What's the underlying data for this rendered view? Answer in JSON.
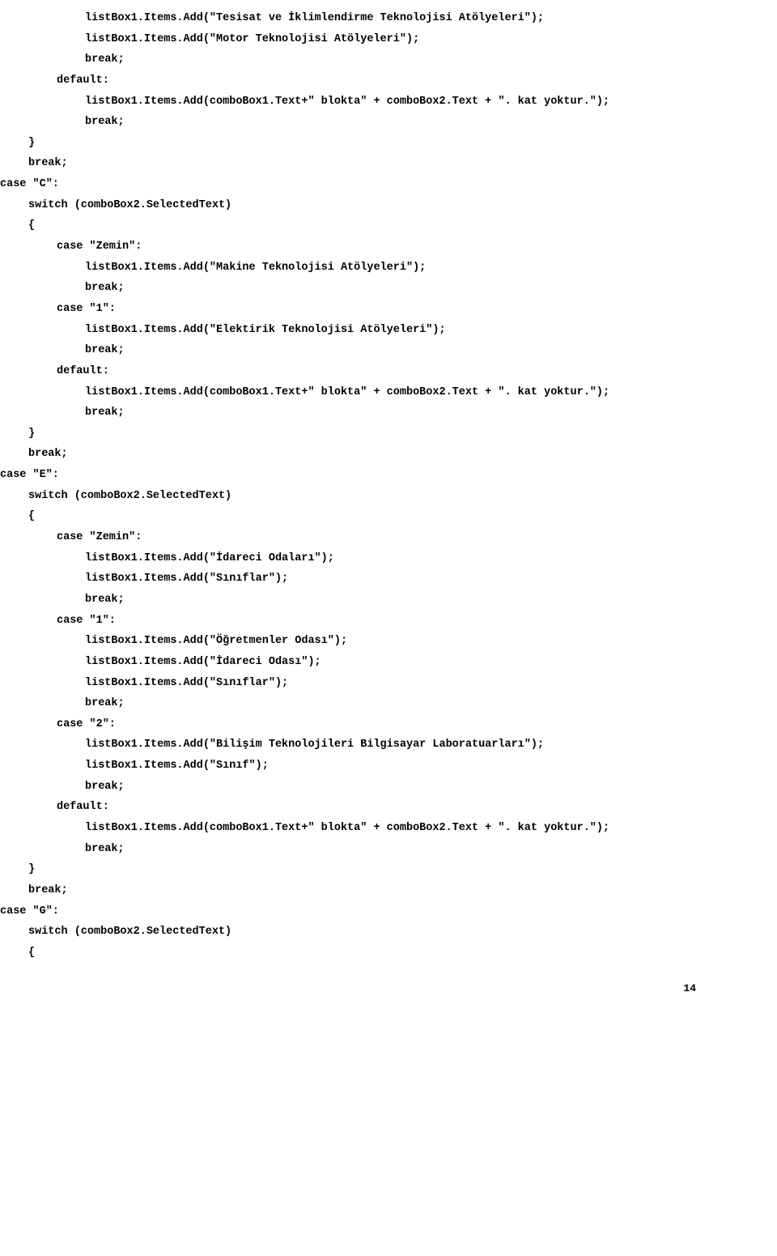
{
  "lines": [
    {
      "cls": "i3",
      "t": "listBox1.Items.Add(\"Tesisat ve İklimlendirme Teknolojisi Atölyeleri\");"
    },
    {
      "cls": "i3",
      "t": "listBox1.Items.Add(\"Motor Teknolojisi Atölyeleri\");"
    },
    {
      "cls": "i3",
      "t": "break;"
    },
    {
      "cls": "i2",
      "t": "default:"
    },
    {
      "cls": "i3",
      "t": "listBox1.Items.Add(comboBox1.Text+\" blokta\" + comboBox2.Text + \". kat yoktur.\");"
    },
    {
      "cls": "i3",
      "t": "break;"
    },
    {
      "cls": "i1",
      "t": "}"
    },
    {
      "cls": "i1",
      "t": "break;"
    },
    {
      "cls": "i0",
      "t": "case \"C\":"
    },
    {
      "cls": "i1",
      "t": "switch (comboBox2.SelectedText)"
    },
    {
      "cls": "i1",
      "t": "{"
    },
    {
      "cls": "i2",
      "t": "case \"Zemin\":"
    },
    {
      "cls": "i3",
      "t": "listBox1.Items.Add(\"Makine Teknolojisi Atölyeleri\");"
    },
    {
      "cls": "i3",
      "t": "break;"
    },
    {
      "cls": "i2",
      "t": "case \"1\":"
    },
    {
      "cls": "i3",
      "t": "listBox1.Items.Add(\"Elektirik Teknolojisi Atölyeleri\");"
    },
    {
      "cls": "i3",
      "t": "break;"
    },
    {
      "cls": "i2",
      "t": "default:"
    },
    {
      "cls": "i3",
      "t": "listBox1.Items.Add(comboBox1.Text+\" blokta\" + comboBox2.Text + \". kat yoktur.\");"
    },
    {
      "cls": "i3",
      "t": "break;"
    },
    {
      "cls": "i1",
      "t": "}"
    },
    {
      "cls": "i1",
      "t": "break;"
    },
    {
      "cls": "i0",
      "t": "case \"E\":"
    },
    {
      "cls": "i1",
      "t": "switch (comboBox2.SelectedText)"
    },
    {
      "cls": "i1",
      "t": "{"
    },
    {
      "cls": "i2",
      "t": "case \"Zemin\":"
    },
    {
      "cls": "i3",
      "t": "listBox1.Items.Add(\"İdareci Odaları\");"
    },
    {
      "cls": "i3",
      "t": "listBox1.Items.Add(\"Sınıflar\");"
    },
    {
      "cls": "i3",
      "t": "break;"
    },
    {
      "cls": "i2",
      "t": "case \"1\":"
    },
    {
      "cls": "i3",
      "t": "listBox1.Items.Add(\"Öğretmenler Odası\");"
    },
    {
      "cls": "i3",
      "t": "listBox1.Items.Add(\"İdareci Odası\");"
    },
    {
      "cls": "i3",
      "t": "listBox1.Items.Add(\"Sınıflar\");"
    },
    {
      "cls": "i3",
      "t": "break;"
    },
    {
      "cls": "i2",
      "t": "case \"2\":"
    },
    {
      "cls": "i3",
      "t": "listBox1.Items.Add(\"Bilişim Teknolojileri Bilgisayar Laboratuarları\");"
    },
    {
      "cls": "i3",
      "t": "listBox1.Items.Add(\"Sınıf\");"
    },
    {
      "cls": "i3",
      "t": "break;"
    },
    {
      "cls": "i2",
      "t": "default:"
    },
    {
      "cls": "i3",
      "t": "listBox1.Items.Add(comboBox1.Text+\" blokta\" + comboBox2.Text + \". kat yoktur.\");"
    },
    {
      "cls": "i3",
      "t": "break;"
    },
    {
      "cls": "i1",
      "t": "}"
    },
    {
      "cls": "i1",
      "t": "break;"
    },
    {
      "cls": "i0",
      "t": "case \"G\":"
    },
    {
      "cls": "i1",
      "t": "switch (comboBox2.SelectedText)"
    },
    {
      "cls": "i1",
      "t": "{"
    }
  ],
  "page_number": "14"
}
